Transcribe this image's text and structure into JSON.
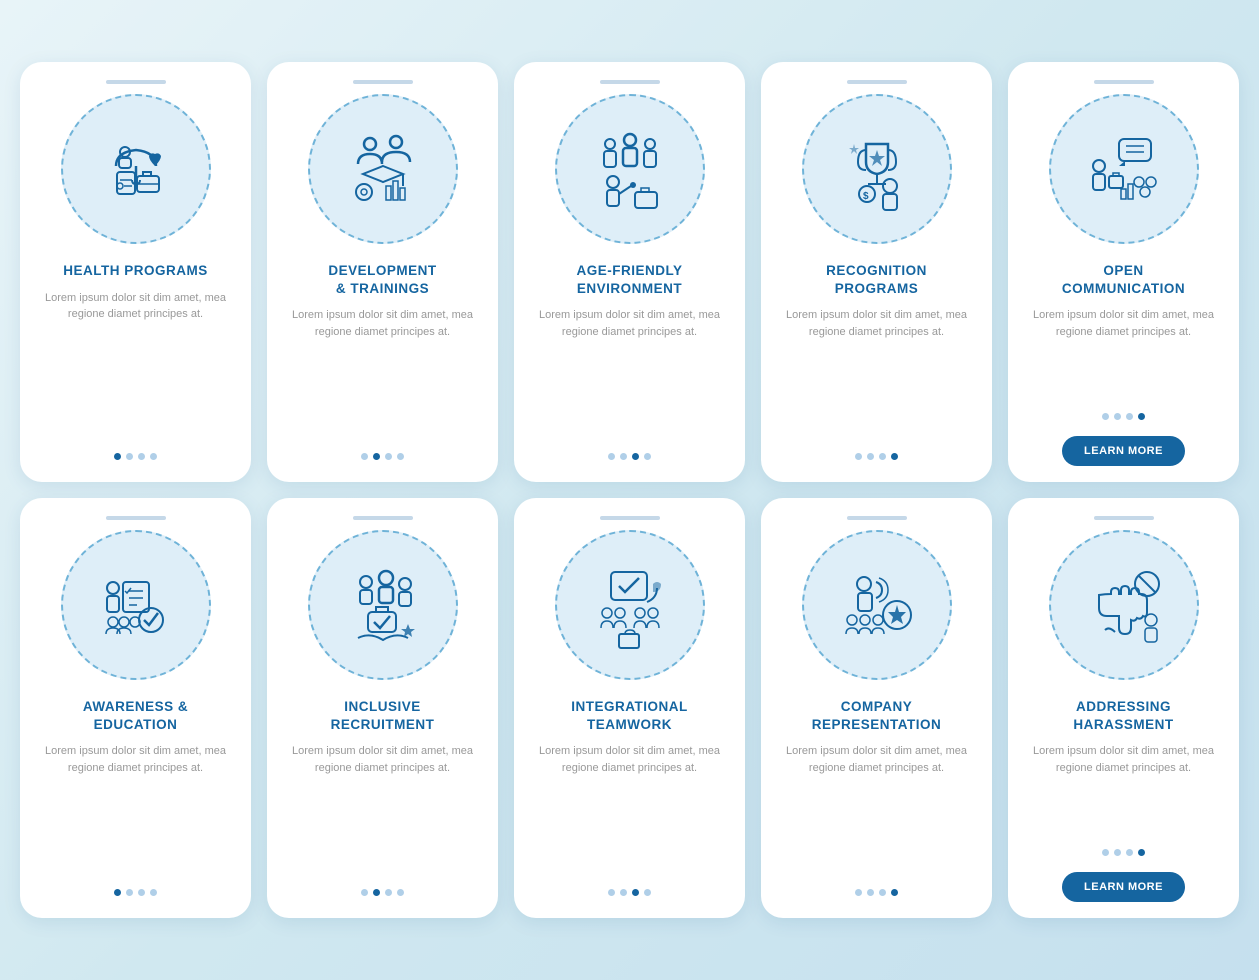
{
  "cards": [
    {
      "id": "health-programs",
      "title": "HEALTH PROGRAMS",
      "body": "Lorem ipsum dolor sit dim amet, mea regione diamet principes at.",
      "dots": [
        true,
        false,
        false,
        false
      ],
      "has_button": false,
      "button_label": ""
    },
    {
      "id": "development-trainings",
      "title": "DEVELOPMENT\n& TRAININGS",
      "body": "Lorem ipsum dolor sit dim amet, mea regione diamet principes at.",
      "dots": [
        false,
        true,
        false,
        false
      ],
      "has_button": false,
      "button_label": ""
    },
    {
      "id": "age-friendly-environment",
      "title": "AGE-FRIENDLY\nENVIRONMENT",
      "body": "Lorem ipsum dolor sit dim amet, mea regione diamet principes at.",
      "dots": [
        false,
        false,
        true,
        false
      ],
      "has_button": false,
      "button_label": ""
    },
    {
      "id": "recognition-programs",
      "title": "RECOGNITION\nPROGRAMS",
      "body": "Lorem ipsum dolor sit dim amet, mea regione diamet principes at.",
      "dots": [
        false,
        false,
        false,
        true
      ],
      "has_button": false,
      "button_label": ""
    },
    {
      "id": "open-communication",
      "title": "OPEN\nCOMMUNICATION",
      "body": "Lorem ipsum dolor sit dim amet, mea regione diamet principes at.",
      "dots": [
        false,
        false,
        false,
        true
      ],
      "has_button": true,
      "button_label": "LEARN MORE"
    },
    {
      "id": "awareness-education",
      "title": "AWARENESS &\nEDUCATION",
      "body": "Lorem ipsum dolor sit dim amet, mea regione diamet principes at.",
      "dots": [
        true,
        false,
        false,
        false
      ],
      "has_button": false,
      "button_label": ""
    },
    {
      "id": "inclusive-recruitment",
      "title": "INCLUSIVE\nRECRUITMENT",
      "body": "Lorem ipsum dolor sit dim amet, mea regione diamet principes at.",
      "dots": [
        false,
        true,
        false,
        false
      ],
      "has_button": false,
      "button_label": ""
    },
    {
      "id": "integrational-teamwork",
      "title": "INTEGRATIONAL\nTEAMWORK",
      "body": "Lorem ipsum dolor sit dim amet, mea regione diamet principes at.",
      "dots": [
        false,
        false,
        true,
        false
      ],
      "has_button": false,
      "button_label": ""
    },
    {
      "id": "company-representation",
      "title": "COMPANY\nREPRESENTATION",
      "body": "Lorem ipsum dolor sit dim amet, mea regione diamet principes at.",
      "dots": [
        false,
        false,
        false,
        true
      ],
      "has_button": false,
      "button_label": ""
    },
    {
      "id": "addressing-harassment",
      "title": "ADDRESSING\nHARASSMENT",
      "body": "Lorem ipsum dolor sit dim amet, mea regione diamet principes at.",
      "dots": [
        false,
        false,
        false,
        true
      ],
      "has_button": true,
      "button_label": "LEARN MORE"
    }
  ]
}
